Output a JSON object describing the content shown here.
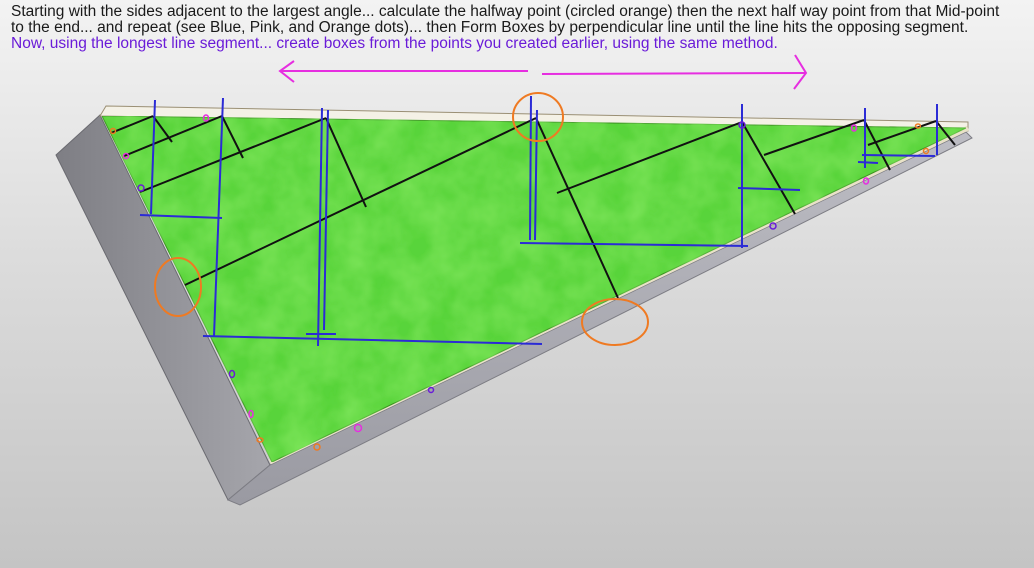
{
  "instructions": {
    "line1": "Starting with the sides adjacent to the largest angle... calculate the halfway point (circled orange) then the next half way point from that Mid-point",
    "line2": "to the end... and repeat (see Blue, Pink, and Orange dots)... then Form Boxes by perpendicular line until the line hits the opposing segment.",
    "line3": "Now, using the longest line segment... create boxes from the points you created earlier, using the same method."
  },
  "colors": {
    "panel_green": "#58d43a",
    "blue_lines": "#2b2bd6",
    "black_lines": "#111111",
    "orange_circles": "#ef7a22",
    "magenta_arrows": "#e62ee0",
    "edge_gray": "#8e8e92"
  }
}
